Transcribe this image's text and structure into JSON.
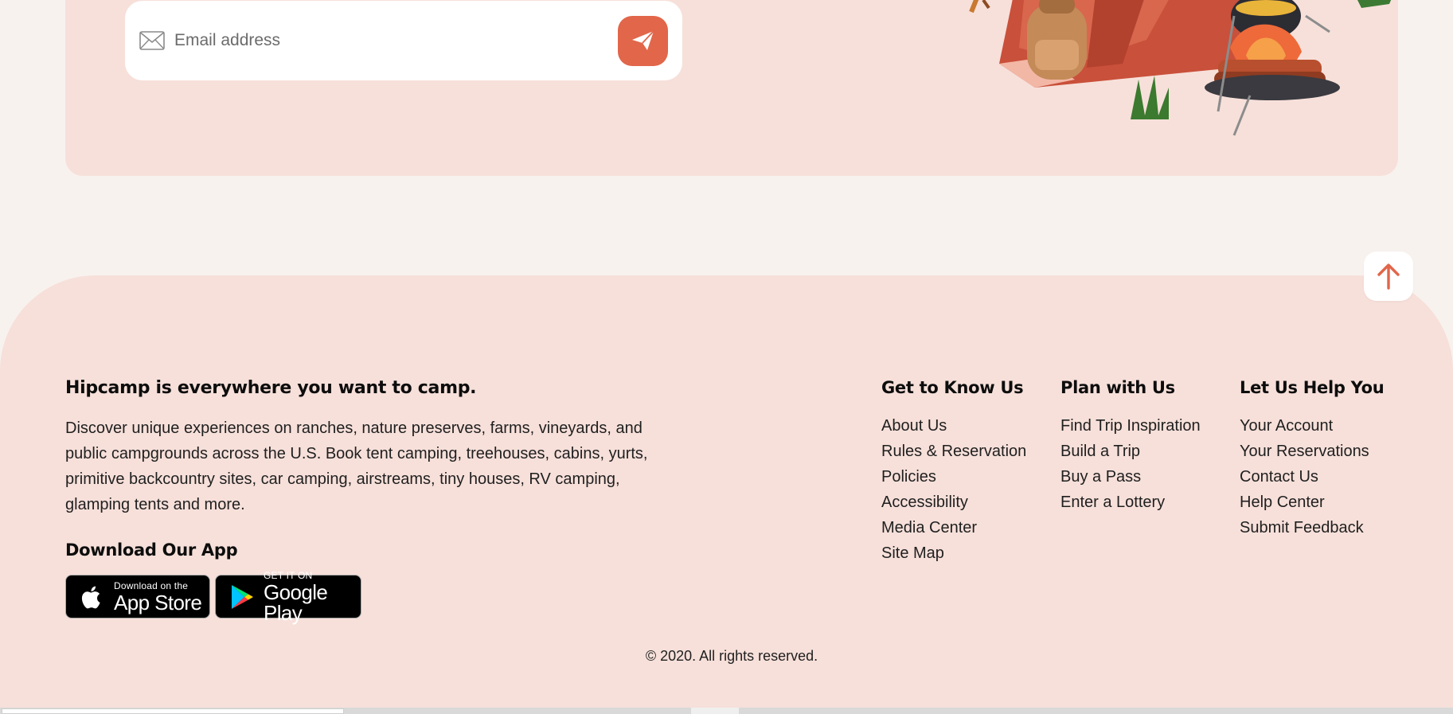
{
  "newsletter": {
    "email_placeholder": "Email address"
  },
  "footer": {
    "about": {
      "title": "Hipcamp is everywhere you want to camp.",
      "text": "Discover unique experiences on ranches, nature preserves, farms, vineyards, and public campgrounds across the U.S. Book tent camping, treehouses, cabins, yurts, primitive backcountry sites, car camping, airstreams, tiny houses, RV camping, glamping tents and more."
    },
    "app": {
      "title": "Download Our App",
      "apple": {
        "small": "Download on the",
        "big": "App Store"
      },
      "google": {
        "small": "GET IT ON",
        "big": "Google Play"
      }
    },
    "columns": [
      {
        "title": "Get to Know Us",
        "items": [
          "About Us",
          "Rules & Reservation",
          "Policies",
          "Accessibility",
          "Media Center",
          "Site Map"
        ]
      },
      {
        "title": "Plan with Us",
        "items": [
          "Find Trip Inspiration",
          "Build a Trip",
          "Buy a Pass",
          "Enter a Lottery"
        ]
      },
      {
        "title": "Let Us Help You",
        "items": [
          "Your Account",
          "Your Reservations",
          "Contact Us",
          "Help Center",
          "Submit Feedback"
        ]
      }
    ],
    "copyright": "© 2020. All rights reserved."
  },
  "colors": {
    "accent": "#e1664a",
    "card_bg": "#f7e0da",
    "page_bg": "#f8f2ef"
  },
  "icons": {
    "email": "mail-icon",
    "send": "paper-plane-icon",
    "scroll_top": "arrow-up-icon",
    "apple": "apple-logo-icon",
    "google": "google-play-logo-icon"
  }
}
